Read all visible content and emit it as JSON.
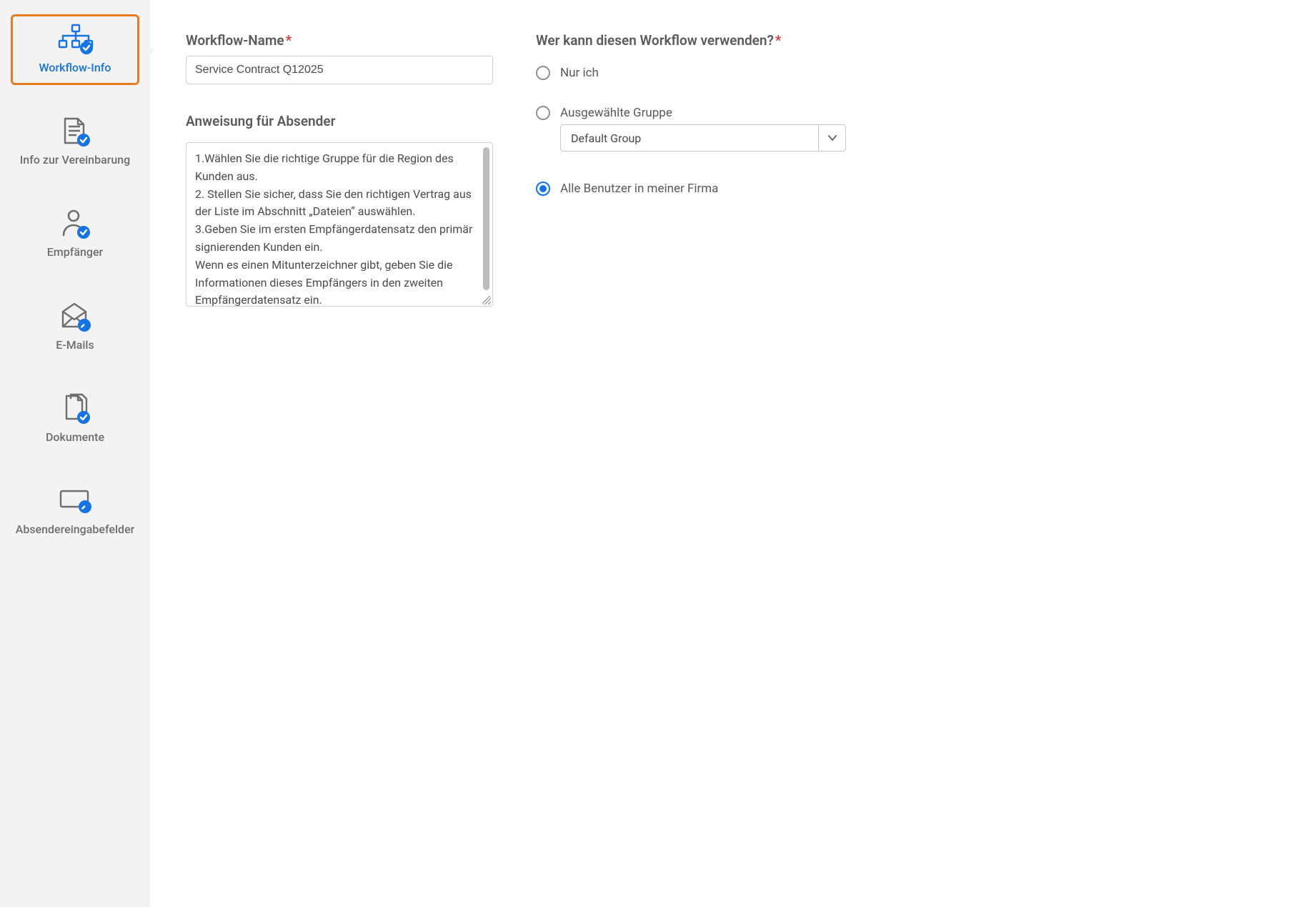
{
  "sidebar": {
    "items": [
      {
        "label": "Workflow-Info"
      },
      {
        "label": "Info zur Vereinbarung"
      },
      {
        "label": "Empfänger"
      },
      {
        "label": "E-Mails"
      },
      {
        "label": "Dokumente"
      },
      {
        "label": "Absendereingabefelder"
      }
    ],
    "active_index": 0
  },
  "form": {
    "workflow_name_label": "Workflow-Name",
    "workflow_name_value": "Service Contract Q12025",
    "instructions_label": "Anweisung für Absender",
    "instructions_value": "1.Wählen Sie die richtige Gruppe für die Region des Kunden aus.\n2. Stellen Sie sicher, dass Sie den richtigen Vertrag aus der Liste im Abschnitt „Dateien“ auswählen.\n3.Geben Sie im ersten Empfängerdatensatz den primär signierenden Kunden ein.\nWenn es einen Mitunterzeichner gibt, geben Sie die Informationen dieses Empfängers in den zweiten Empfängerdatensatz ein."
  },
  "permissions": {
    "heading": "Wer kann diesen Workflow verwenden?",
    "options": [
      {
        "key": "only_me",
        "label": "Nur ich"
      },
      {
        "key": "selected_group",
        "label": "Ausgewählte Gruppe"
      },
      {
        "key": "all_users",
        "label": "Alle Benutzer in meiner Firma"
      }
    ],
    "selected": "all_users",
    "group_select_value": "Default Group"
  },
  "colors": {
    "accent": "#1473e6",
    "highlight_border": "#e77c22",
    "required": "#d7373f"
  }
}
